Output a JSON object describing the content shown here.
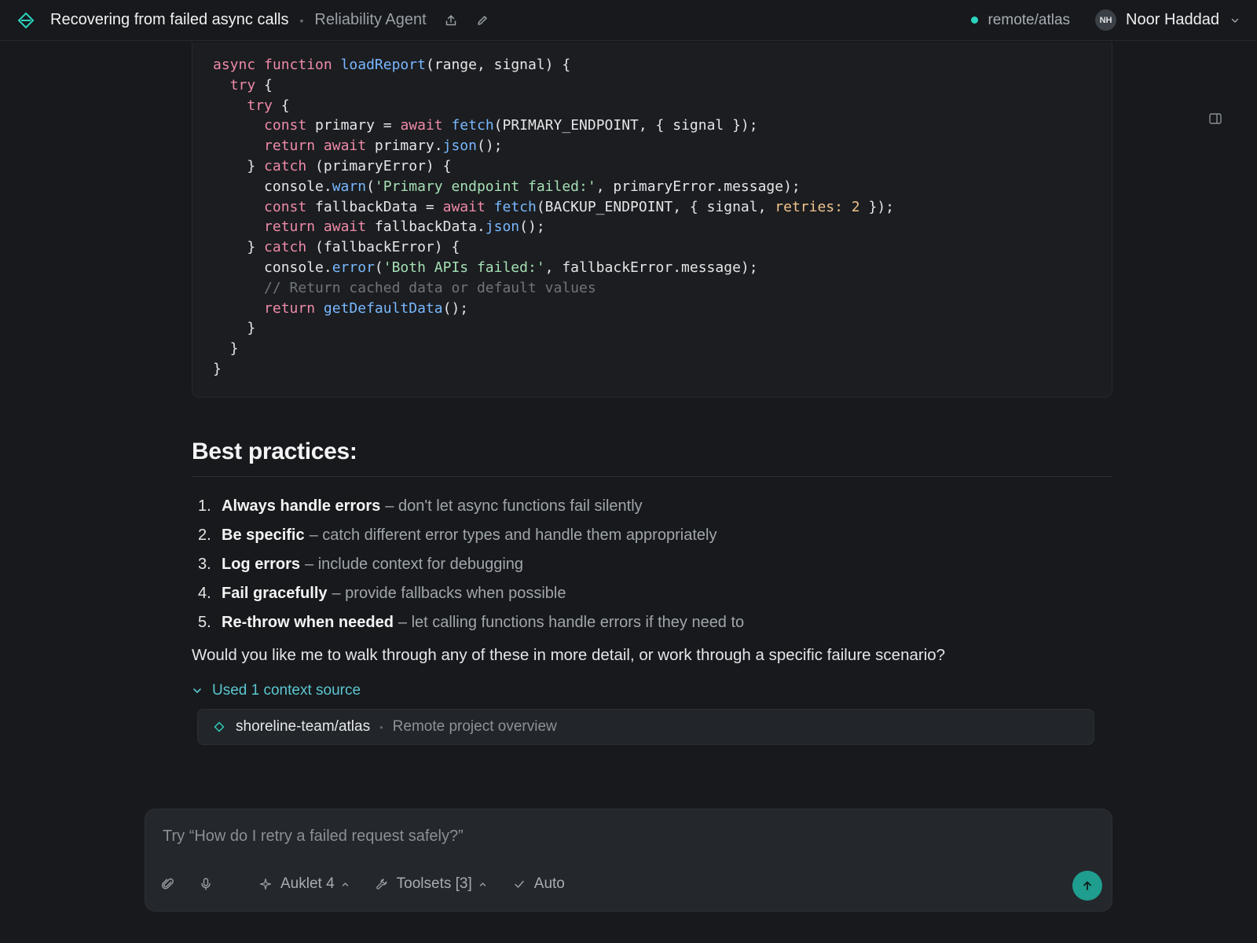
{
  "topbar": {
    "title": "Recovering from failed async calls",
    "separator": "•",
    "agent": "Reliability Agent",
    "remote": "remote/atlas",
    "user_initials": "NH",
    "user_name": "Noor Haddad"
  },
  "code": {
    "lines": [
      [
        [
          "kw",
          "async "
        ],
        [
          "kw",
          "function "
        ],
        [
          "fn",
          "loadReport"
        ],
        [
          "p",
          "(range, signal) {"
        ]
      ],
      [
        [
          "p",
          "  "
        ],
        [
          "kw",
          "try"
        ],
        [
          "p",
          " {"
        ]
      ],
      [
        [
          "p",
          "    "
        ],
        [
          "kw",
          "try"
        ],
        [
          "p",
          " {"
        ]
      ],
      [
        [
          "p",
          "      "
        ],
        [
          "kw",
          "const"
        ],
        [
          "p",
          " primary = "
        ],
        [
          "kw",
          "await "
        ],
        [
          "fn",
          "fetch"
        ],
        [
          "p",
          "(PRIMARY_ENDPOINT, { signal });"
        ]
      ],
      [
        [
          "p",
          "      "
        ],
        [
          "kw",
          "return await"
        ],
        [
          "p",
          " primary."
        ],
        [
          "fn",
          "json"
        ],
        [
          "p",
          "();"
        ]
      ],
      [
        [
          "p",
          "    } "
        ],
        [
          "kw",
          "catch"
        ],
        [
          "p",
          " (primaryError) {"
        ]
      ],
      [
        [
          "p",
          "      console."
        ],
        [
          "fn",
          "warn"
        ],
        [
          "p",
          "("
        ],
        [
          "str",
          "'Primary endpoint failed:'"
        ],
        [
          "p",
          ", primaryError.message);"
        ]
      ],
      [
        [
          "p",
          "      "
        ],
        [
          "kw",
          "const"
        ],
        [
          "p",
          " fallbackData = "
        ],
        [
          "kw",
          "await "
        ],
        [
          "fn",
          "fetch"
        ],
        [
          "p",
          "(BACKUP_ENDPOINT, { signal, "
        ],
        [
          "num",
          "retries: 2"
        ],
        [
          "p",
          " });"
        ]
      ],
      [
        [
          "p",
          "      "
        ],
        [
          "kw",
          "return await"
        ],
        [
          "p",
          " fallbackData."
        ],
        [
          "fn",
          "json"
        ],
        [
          "p",
          "();"
        ]
      ],
      [
        [
          "p",
          "    } "
        ],
        [
          "kw",
          "catch"
        ],
        [
          "p",
          " (fallbackError) {"
        ]
      ],
      [
        [
          "p",
          "      console."
        ],
        [
          "fn",
          "error"
        ],
        [
          "p",
          "("
        ],
        [
          "str",
          "'Both APIs failed:'"
        ],
        [
          "p",
          ", fallbackError.message);"
        ]
      ],
      [
        [
          "p",
          "      "
        ],
        [
          "cm",
          "// Return cached data or default values"
        ]
      ],
      [
        [
          "p",
          "      "
        ],
        [
          "kw",
          "return "
        ],
        [
          "fn",
          "getDefaultData"
        ],
        [
          "p",
          "();"
        ]
      ],
      [
        [
          "p",
          "    }"
        ]
      ],
      [
        [
          "p",
          "  }"
        ]
      ],
      [
        [
          "p",
          "}"
        ]
      ]
    ]
  },
  "best_practices": {
    "heading": "Best practices:",
    "items": [
      {
        "num": "1.",
        "title": "Always handle errors",
        "desc": "– don't let async functions fail silently"
      },
      {
        "num": "2.",
        "title": "Be specific",
        "desc": "– catch different error types and handle them appropriately"
      },
      {
        "num": "3.",
        "title": "Log errors",
        "desc": "– include context for debugging"
      },
      {
        "num": "4.",
        "title": "Fail gracefully",
        "desc": "– provide fallbacks when possible"
      },
      {
        "num": "5.",
        "title": "Re-throw when needed",
        "desc": "– let calling functions handle errors if they need to"
      }
    ]
  },
  "followup": "Would you like me to walk through any of these in more detail, or work through a specific failure scenario?",
  "context": {
    "toggle_label": "Used 1 context source",
    "source_name": "shoreline-team/atlas",
    "separator": "•",
    "source_desc": "Remote project overview"
  },
  "composer": {
    "placeholder": "Try “How do I retry a failed request safely?”",
    "value": "",
    "model_label": "Auklet 4",
    "toolsets_label": "Toolsets [3]",
    "auto_label": "Auto"
  },
  "colors": {
    "accent": "#2dd4bf",
    "send_button": "#1f9d8e",
    "link": "#5cc6d0",
    "background": "#17191c"
  },
  "icons": {
    "logo": "diamond-logo-icon",
    "share": "share-icon",
    "edit": "pencil-icon",
    "panel": "sidebar-panel-icon",
    "attach": "paperclip-icon",
    "mic": "microphone-icon",
    "model": "sparkle-icon",
    "toolsets": "wrench-icon",
    "auto": "check-icon",
    "send": "arrow-up-icon"
  }
}
